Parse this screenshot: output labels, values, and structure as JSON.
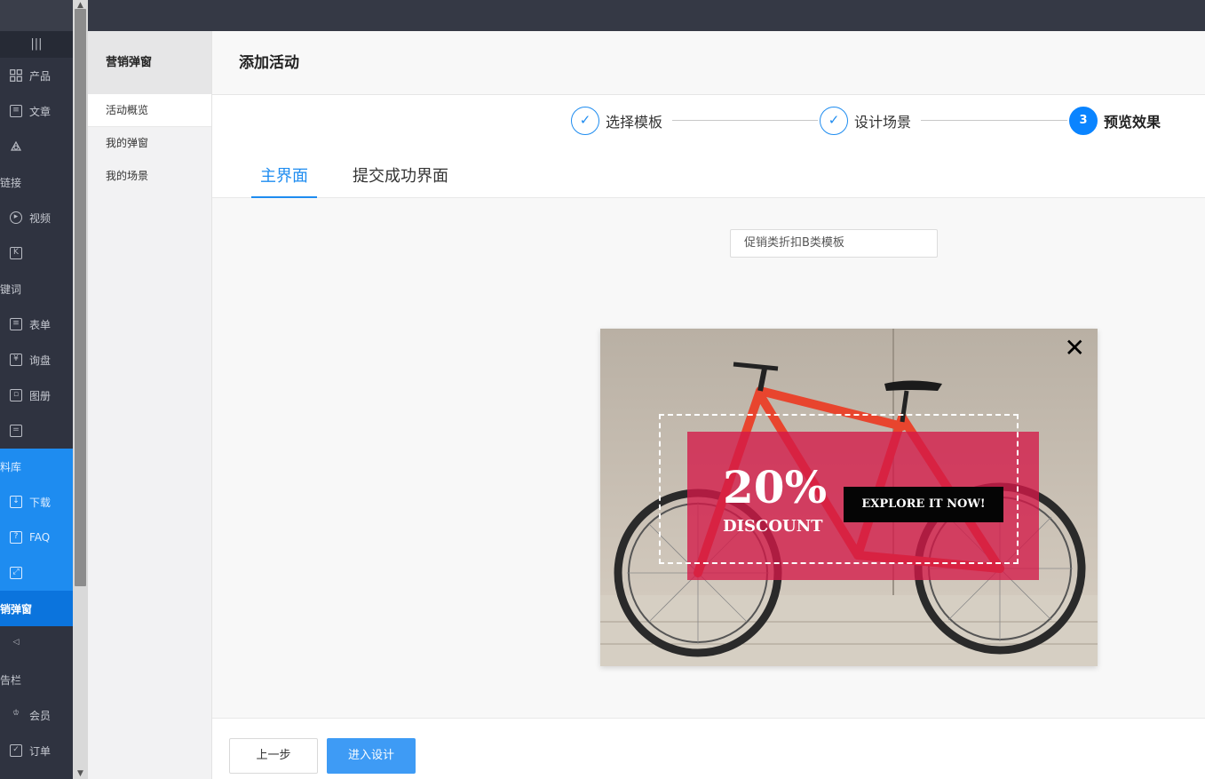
{
  "leftnav": {
    "toggle_icon": "|||",
    "items": [
      {
        "label": "产品",
        "icon": "grid-icon"
      },
      {
        "label": "文章",
        "icon": "document-icon"
      },
      {
        "label": "",
        "icon": "link-icon"
      },
      {
        "label": "短链接",
        "icon": ""
      },
      {
        "label": "视频",
        "icon": "play-icon"
      },
      {
        "label": "",
        "icon": "keyword-icon"
      },
      {
        "label": "关键词",
        "icon": ""
      },
      {
        "label": "表单",
        "icon": "clipboard-icon"
      },
      {
        "label": "询盘",
        "icon": "yen-icon"
      },
      {
        "label": "图册",
        "icon": "gallery-icon"
      },
      {
        "label": "",
        "icon": "server-icon"
      },
      {
        "label": "资料库",
        "icon": ""
      },
      {
        "label": "下载",
        "icon": "download-icon"
      },
      {
        "label": "FAQ",
        "icon": "question-icon"
      },
      {
        "label": "",
        "icon": "expand-icon"
      },
      {
        "label": "营销弹窗",
        "icon": ""
      },
      {
        "label": "",
        "icon": "speaker-icon"
      },
      {
        "label": "公告栏",
        "icon": ""
      },
      {
        "label": "会员",
        "icon": "crown-icon"
      },
      {
        "label": "订单",
        "icon": "order-icon"
      }
    ]
  },
  "subnav": {
    "title": "营销弹窗",
    "items": [
      "活动概览",
      "我的弹窗",
      "我的场景"
    ]
  },
  "page": {
    "title": "添加活动"
  },
  "steps": [
    {
      "label": "选择模板",
      "state": "done"
    },
    {
      "label": "设计场景",
      "state": "done"
    },
    {
      "label": "预览效果",
      "state": "current",
      "number": "3"
    }
  ],
  "tabs": [
    "主界面",
    "提交成功界面"
  ],
  "template_select": {
    "value": "促销类折扣B类模板"
  },
  "popup": {
    "close": "✕",
    "percent": "20%",
    "discount": "DISCOUNT",
    "cta": "EXPLORE IT NOW!",
    "overlay_color": "#d41848"
  },
  "buttons": {
    "prev": "上一步",
    "next": "进入设计"
  },
  "colors": {
    "accent": "#1e8cf0",
    "nav_dark": "#2f3340"
  }
}
